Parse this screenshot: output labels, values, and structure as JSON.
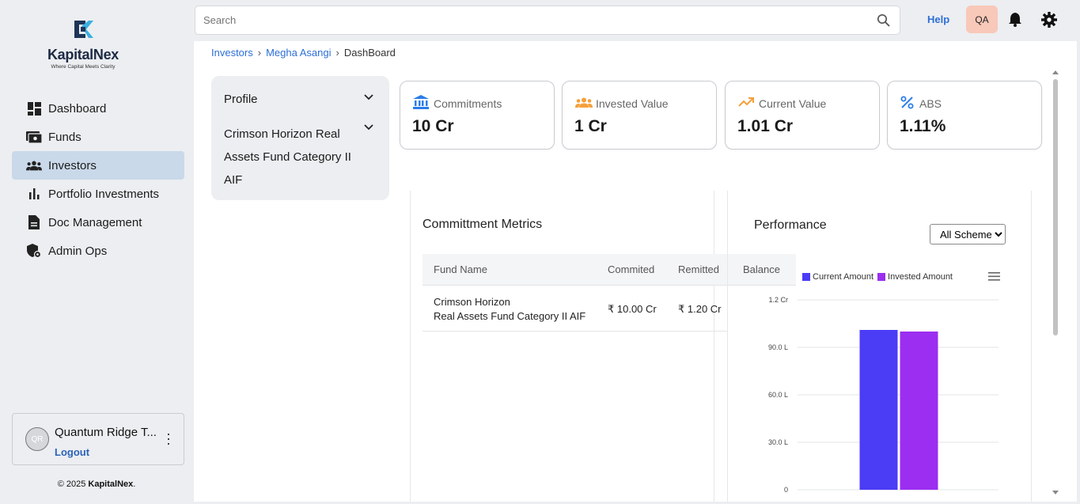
{
  "brand": {
    "name": "KapitalNex",
    "tagline": "Where Capital Meets Clarity"
  },
  "sidebar": {
    "items": [
      {
        "label": "Dashboard",
        "icon": "dashboard-icon"
      },
      {
        "label": "Funds",
        "icon": "funds-icon"
      },
      {
        "label": "Investors",
        "icon": "investors-icon",
        "active": true
      },
      {
        "label": "Portfolio Investments",
        "icon": "bar-chart-icon"
      },
      {
        "label": "Doc Management",
        "icon": "document-icon"
      },
      {
        "label": "Admin Ops",
        "icon": "shield-icon"
      }
    ],
    "user": {
      "initials": "QR",
      "name": "Quantum Ridge T...",
      "logout": "Logout"
    },
    "copyright_prefix": "© 2025 ",
    "copyright_brand": "KapitalNex",
    "copyright_suffix": "."
  },
  "topbar": {
    "search_placeholder": "Search",
    "help": "Help",
    "user_badge": "QA"
  },
  "breadcrumb": [
    "Investors",
    "Megha Asangi",
    "DashBoard"
  ],
  "profile_panel": {
    "profile": "Profile",
    "fund_line1": "Crimson Horizon Real",
    "fund_line2": "Assets Fund Category II",
    "fund_line3": "AIF"
  },
  "cards": [
    {
      "label": "Commitments",
      "value": "10 Cr",
      "icon": "bank-icon",
      "color": "#2b7de9"
    },
    {
      "label": "Invested Value",
      "value": "1 Cr",
      "icon": "group-icon",
      "color": "#f5a03a"
    },
    {
      "label": "Current Value",
      "value": "1.01 Cr",
      "icon": "trending-up-icon",
      "color": "#f5a03a"
    },
    {
      "label": "ABS",
      "value": "1.11%",
      "icon": "percent-icon",
      "color": "#2b7de9"
    }
  ],
  "metrics": {
    "title": "Committment Metrics",
    "headers": [
      "Fund Name",
      "Commited",
      "Remitted",
      "Balance"
    ],
    "rows": [
      {
        "fund_line1": "Crimson Horizon",
        "fund_line2": "Real Assets Fund Category II AIF",
        "commited": "₹ 10.00 Cr",
        "remitted": "₹ 1.20 Cr"
      }
    ]
  },
  "performance": {
    "title": "Performance",
    "scheme_selected": "All Schemes"
  },
  "colors": {
    "current": "#4b3cf5",
    "invested": "#9b2ef0",
    "active_nav": "#c9d9ea",
    "link": "#2d6fd6"
  },
  "chart_data": {
    "type": "bar",
    "categories": [
      ""
    ],
    "series": [
      {
        "name": "Current Amount",
        "values": [
          101
        ]
      },
      {
        "name": "Invested Amount",
        "values": [
          100
        ]
      }
    ],
    "yticks": [
      "0",
      "30.0 L",
      "60.0 L",
      "90.0 L",
      "1.2 Cr"
    ],
    "ylim": [
      0,
      120
    ],
    "legend": "top-left"
  }
}
